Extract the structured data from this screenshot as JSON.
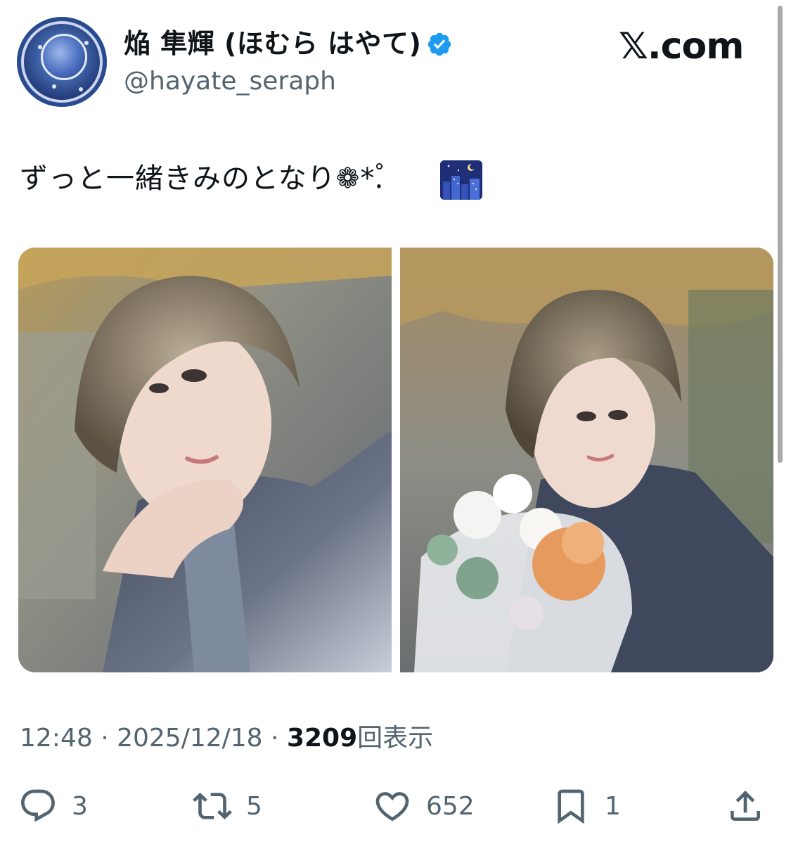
{
  "header": {
    "display_name": "焔 隼輝 (ほむら はやて)",
    "handle": "@hayate_seraph",
    "site_logo": "𝕏.com",
    "verified_color": "#1d9bf0"
  },
  "tweet": {
    "text": "ずっと一緒きみのとなり❁*.゚",
    "emoji_icon": "night-city-emoji",
    "images": [
      {
        "name": "photo-1",
        "description_icon": "portrait-photo"
      },
      {
        "name": "photo-2",
        "description_icon": "portrait-photo-bouquet"
      }
    ]
  },
  "meta": {
    "time": "12:48",
    "separator": " · ",
    "date": "2025/12/18",
    "views_count": "3209",
    "views_label": "回表示"
  },
  "actions": {
    "reply_count": "3",
    "retweet_count": "5",
    "like_count": "652",
    "bookmark_count": "1"
  },
  "colors": {
    "text_primary": "#0f1419",
    "text_secondary": "#536471"
  }
}
